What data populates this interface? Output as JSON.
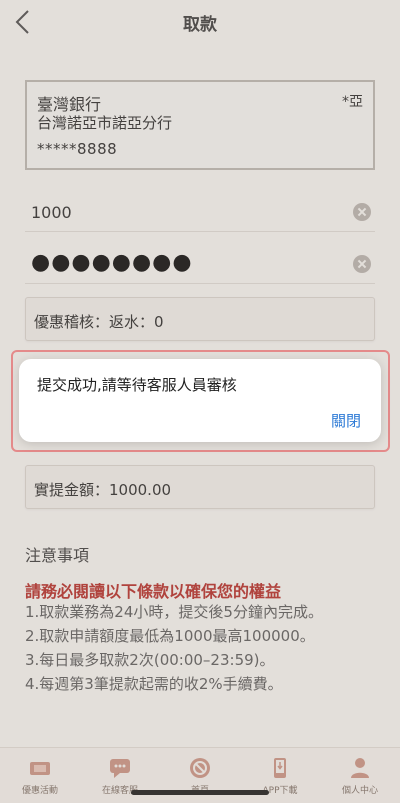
{
  "header": {
    "title": "取款"
  },
  "bank": {
    "name": "臺灣銀行",
    "owner": "*亞",
    "branch": "台灣諾亞市諾亞分行",
    "account": "*****8888"
  },
  "amount_input": {
    "value": "1000"
  },
  "password_input": {
    "masked_value": "●●●●●●●●"
  },
  "bonus_audit": {
    "text": "優惠稽核：返水：0"
  },
  "actual_amount": {
    "text": "實提金額：1000.00"
  },
  "notice": {
    "title": "注意事項",
    "warning": "請務必閱讀以下條款以確保您的權益",
    "lines": [
      "1.取款業務為24小時，提交後5分鐘內完成。",
      "2.取款申請額度最低為1000最高100000。",
      "3.每日最多取款2次(00:00–23:59)。",
      "4.每週第3筆提款起需的收2%手續費。"
    ]
  },
  "dialog": {
    "message": "提交成功,請等待客服人員審核",
    "close_label": "關閉"
  },
  "tabbar": {
    "items": [
      {
        "label": "優惠活動",
        "icon": "gift-ticket-icon"
      },
      {
        "label": "在線客服",
        "icon": "chat-bubble-icon"
      },
      {
        "label": "首頁",
        "icon": "home-logo-icon"
      },
      {
        "label": "APP下載",
        "icon": "phone-download-icon"
      },
      {
        "label": "個人中心",
        "icon": "user-icon"
      }
    ]
  },
  "colors": {
    "accent": "#b2241f",
    "link": "#2e7bd6",
    "background": "#f6f4f1"
  }
}
